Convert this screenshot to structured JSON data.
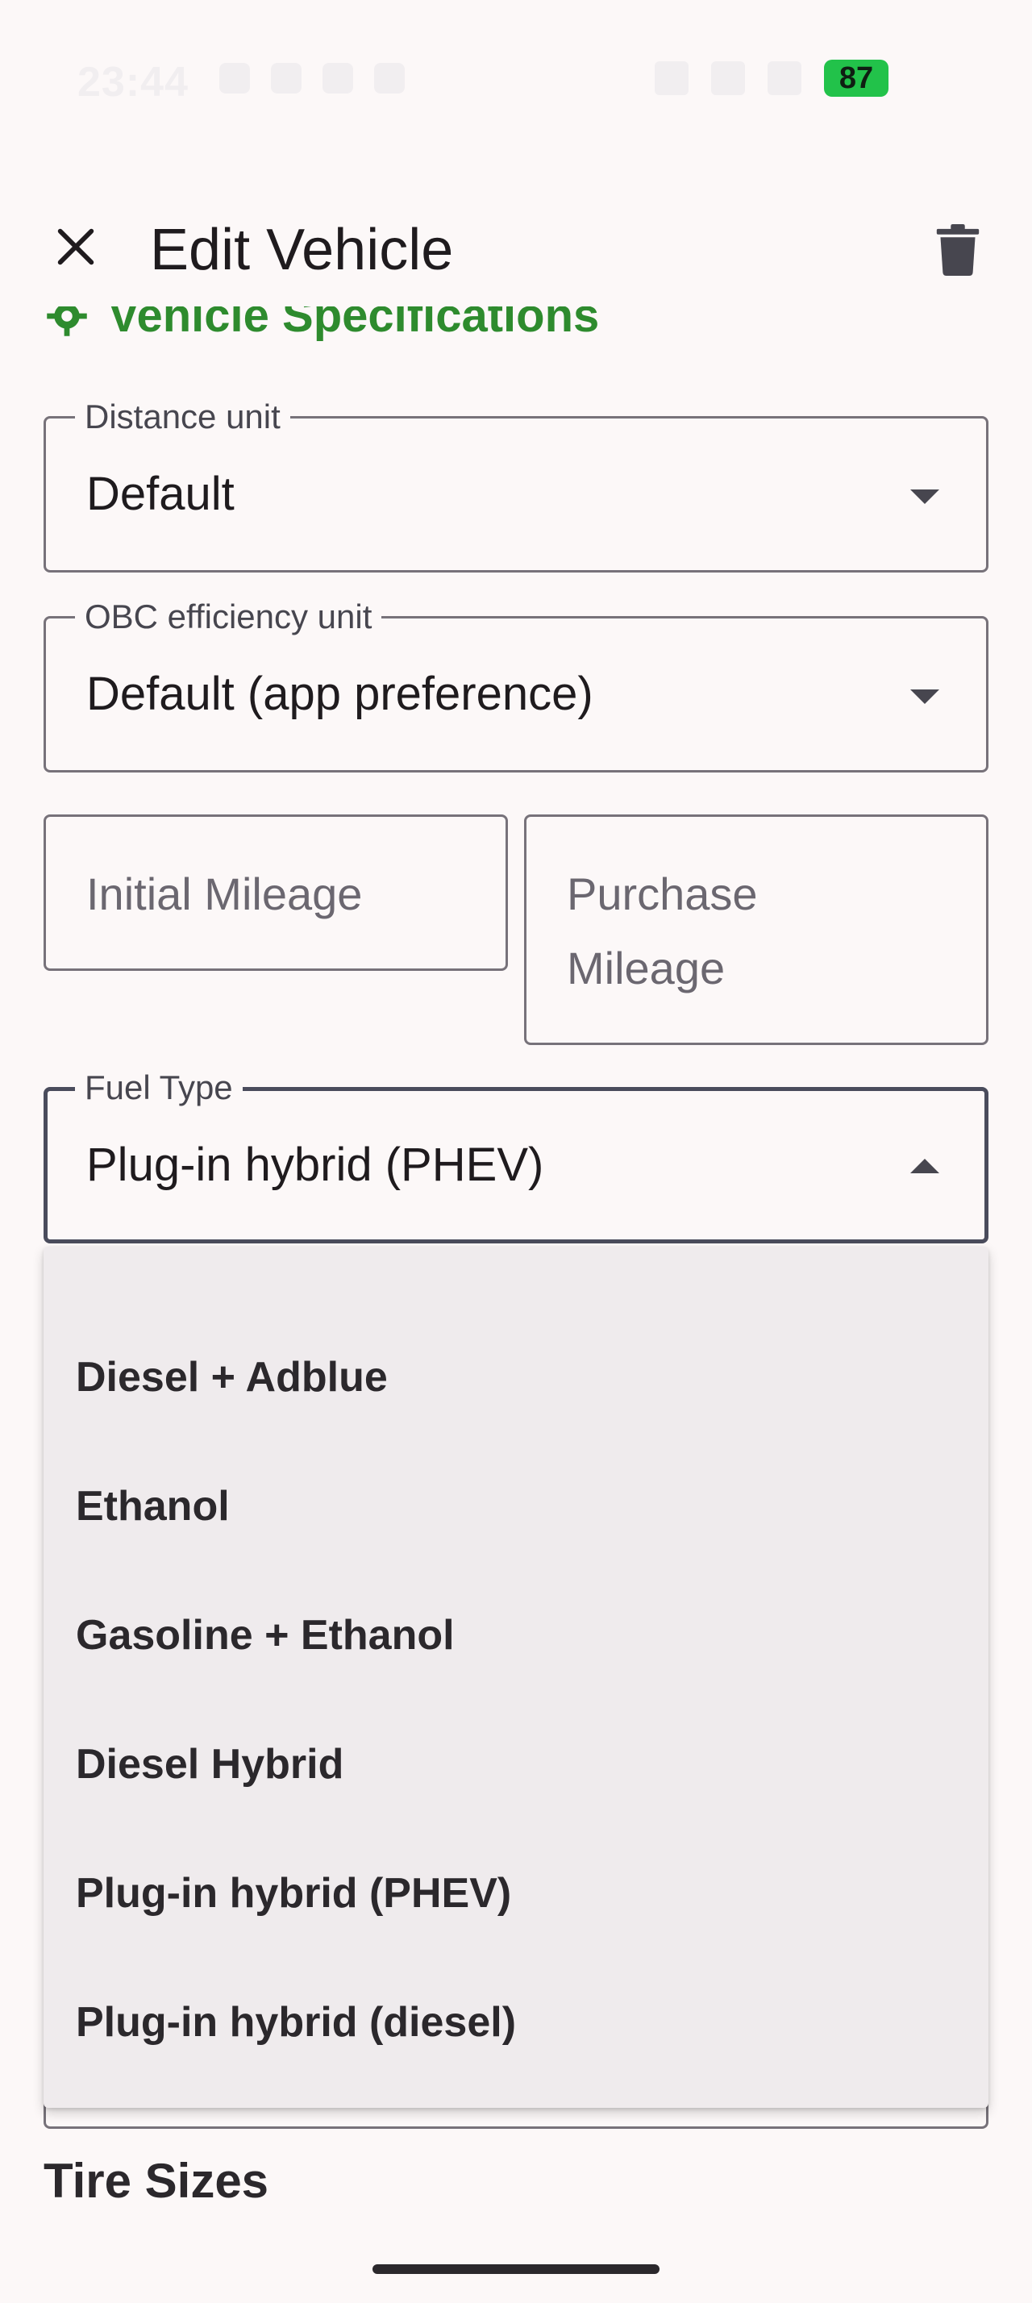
{
  "status_bar": {
    "time": "23:44",
    "battery_level": "87",
    "battery_color": "#22c24a"
  },
  "app_bar": {
    "title": "Edit Vehicle",
    "close_icon": "close-icon",
    "delete_icon": "trash-icon"
  },
  "section": {
    "title": "Vehicle Specifications",
    "icon": "gear-icon",
    "accent_color": "#2e8b2e"
  },
  "fields": {
    "distance_unit": {
      "label": "Distance unit",
      "value": "Default"
    },
    "obc_efficiency_unit": {
      "label": "OBC efficiency unit",
      "value": "Default (app preference)"
    },
    "initial_mileage": {
      "placeholder": "Initial Mileage"
    },
    "purchase_mileage": {
      "placeholder_line1": "Purchase",
      "placeholder_line2": "Mileage"
    },
    "fuel_type": {
      "label": "Fuel Type",
      "value": "Plug-in hybrid (PHEV)",
      "expanded": true
    }
  },
  "fuel_type_menu": {
    "options": [
      "Diesel + Adblue",
      "Ethanol",
      "Gasoline + Ethanol",
      "Diesel Hybrid",
      "Plug-in hybrid (PHEV)",
      "Plug-in hybrid (diesel)"
    ]
  },
  "next_section": {
    "title": "Tire Sizes"
  }
}
